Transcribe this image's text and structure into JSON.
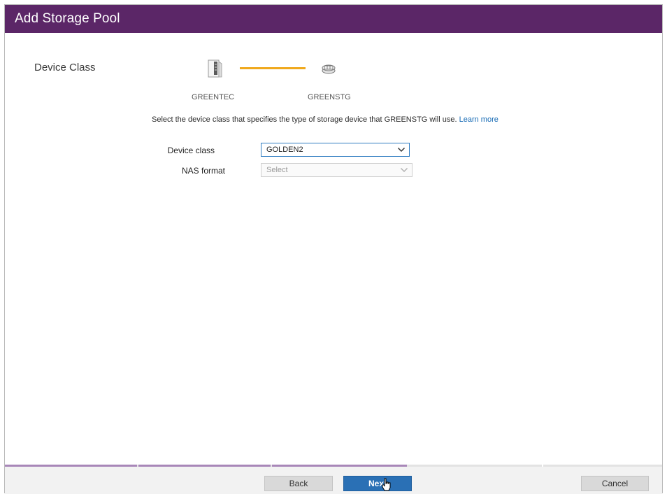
{
  "dialog": {
    "title": "Add Storage Pool"
  },
  "wizard": {
    "current_step_label": "Device Class",
    "source_node": "GREENTEC",
    "target_node": "GREENSTG",
    "instruction": "Select the device class that specifies the type of storage device that GREENSTG will use.",
    "learn_more": "Learn more",
    "progress_fraction": 0.6
  },
  "form": {
    "device_class": {
      "label": "Device class",
      "value": "GOLDEN2"
    },
    "nas_format": {
      "label": "NAS format",
      "placeholder": "Select"
    }
  },
  "footer": {
    "back_label": "Back",
    "next_label": "Next",
    "cancel_label": "Cancel"
  },
  "colors": {
    "title_bar": "#5b2667",
    "connector": "#f0a81c",
    "primary_button": "#2a70b5",
    "link": "#1469b4",
    "progress": "#a887b8"
  },
  "icons": {
    "source": "server-icon",
    "target": "storage-pool-icon",
    "dropdown": "chevron-down-icon"
  }
}
